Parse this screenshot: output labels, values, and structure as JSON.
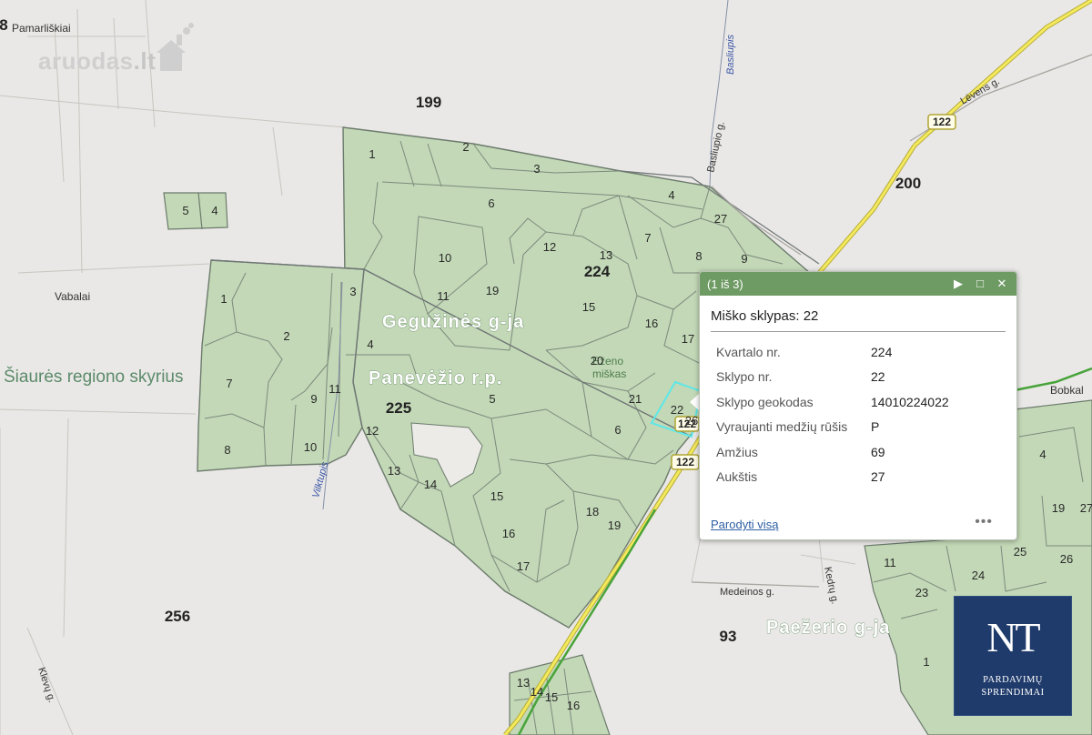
{
  "popup": {
    "paging": "(1 iš 3)",
    "title": "Miško sklypas: 22",
    "fields": [
      {
        "label": "Kvartalo nr.",
        "value": "224"
      },
      {
        "label": "Sklypo nr.",
        "value": "22"
      },
      {
        "label": "Sklypo geokodas",
        "value": "14010224022"
      },
      {
        "label": "Vyraujanti medžių rūšis",
        "value": "P"
      },
      {
        "label": "Amžius",
        "value": "69"
      },
      {
        "label": "Aukštis",
        "value": "27"
      }
    ],
    "show_all": "Parodyti visą",
    "more": "•••"
  },
  "watermark": {
    "name": "aruodas",
    "domain": ".lt"
  },
  "logo": {
    "mark": "NT",
    "line1": "PARDAVIMŲ",
    "line2": "SPRENDIMAI"
  },
  "map": {
    "quarters": [
      "199",
      "200",
      "224",
      "225",
      "256",
      "93",
      "8"
    ],
    "regions": [
      "Šiaurės regiono skyrius",
      "Gegužinės g-ja",
      "Panevėžio r.p.",
      "Paežerio g-ja"
    ],
    "forest_name_lines": [
      "Eženo",
      "miškas"
    ],
    "villages": [
      "Pamarliškiai",
      "Vabalai",
      "Bobkal"
    ],
    "streets": [
      "Basliupio g.",
      "Lėvens g.",
      "Medeinos g.",
      "Kedrų g.",
      "Klevų g."
    ],
    "streams": [
      "Basliupis",
      "Vilktupis"
    ],
    "road_number": "122",
    "plots": {
      "q199": [
        "1",
        "2",
        "3",
        "4",
        "5",
        "6",
        "7",
        "8",
        "9",
        "10",
        "11",
        "12",
        "13",
        "14",
        "15",
        "16",
        "17",
        "19",
        "20",
        "21",
        "22",
        "26",
        "27"
      ],
      "q225": [
        "1",
        "2",
        "3",
        "4",
        "5",
        "6",
        "7",
        "8",
        "9",
        "10",
        "11",
        "12",
        "13",
        "14",
        "15",
        "16",
        "17",
        "18",
        "19"
      ],
      "q224_small": [
        "4",
        "5"
      ],
      "east": [
        "1",
        "4",
        "11",
        "19",
        "23",
        "24",
        "25",
        "26",
        "27"
      ],
      "south": [
        "13",
        "14",
        "15",
        "16"
      ]
    },
    "colors": {
      "forest": "#c2d8b6",
      "boundary": "#6c7a6c",
      "road": "#f0e65a",
      "highlight": "#5ce8e8",
      "popup_header": "#6e9a63"
    }
  }
}
